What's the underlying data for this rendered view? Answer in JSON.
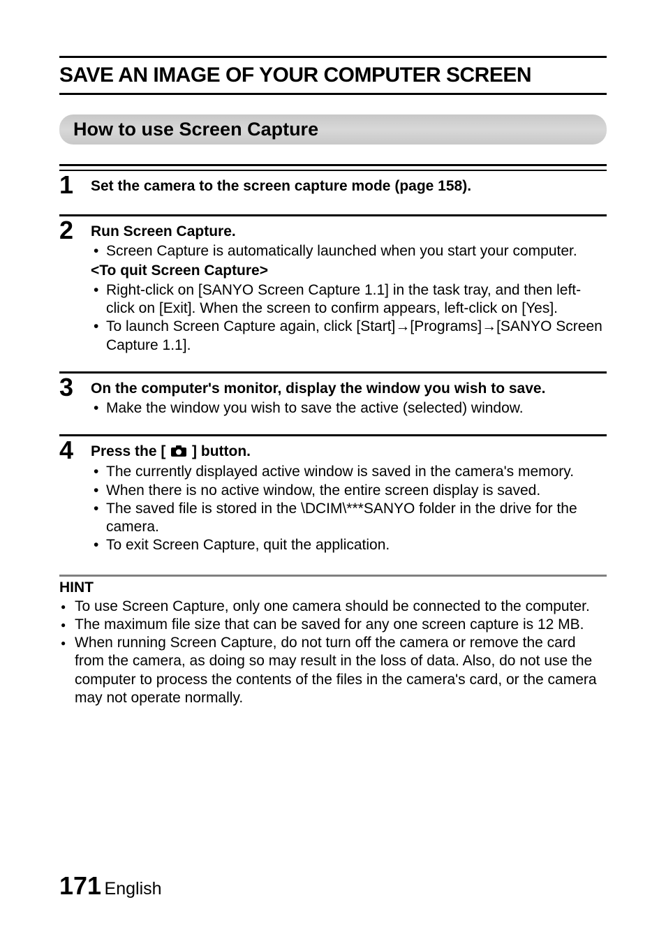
{
  "title": "SAVE AN IMAGE OF YOUR COMPUTER SCREEN",
  "section": "How to use Screen Capture",
  "steps": [
    {
      "num": "1",
      "title": "Set the camera to the screen capture mode (page 158)."
    },
    {
      "num": "2",
      "title": "Run Screen Capture.",
      "bullets_a": [
        "Screen Capture is automatically launched when you start your computer."
      ],
      "subheading": "<To quit Screen Capture>",
      "bullets_b": [
        "Right-click on [SANYO Screen Capture 1.1] in the task tray, and then left-click on [Exit]. When the screen to confirm appears, left-click on [Yes].",
        "To launch Screen Capture again, click [Start]→[Programs]→[SANYO Screen Capture 1.1]."
      ]
    },
    {
      "num": "3",
      "title": "On the computer's monitor, display the window you wish to save.",
      "bullets_a": [
        "Make the window you wish to save the active (selected) window."
      ]
    },
    {
      "num": "4",
      "title_pre": "Press the [ ",
      "title_post": " ] button.",
      "bullets_a": [
        "The currently displayed active window is saved in the camera's memory.",
        "When there is no active window, the entire screen display is saved.",
        "The saved file is stored in the \\DCIM\\***SANYO folder in the drive for the camera.",
        "To exit Screen Capture, quit the application."
      ]
    }
  ],
  "hint": {
    "title": "HINT",
    "items": [
      "To use Screen Capture, only one camera should be connected to the computer.",
      "The maximum file size that can be saved for any one screen capture is 12 MB.",
      "When running Screen Capture, do not turn off the camera or remove the card from the camera, as doing so may result in the loss of data. Also, do not use the computer to process the contents of the files in the camera's card, or the camera may not operate normally."
    ]
  },
  "footer": {
    "page": "171",
    "language": "English"
  }
}
